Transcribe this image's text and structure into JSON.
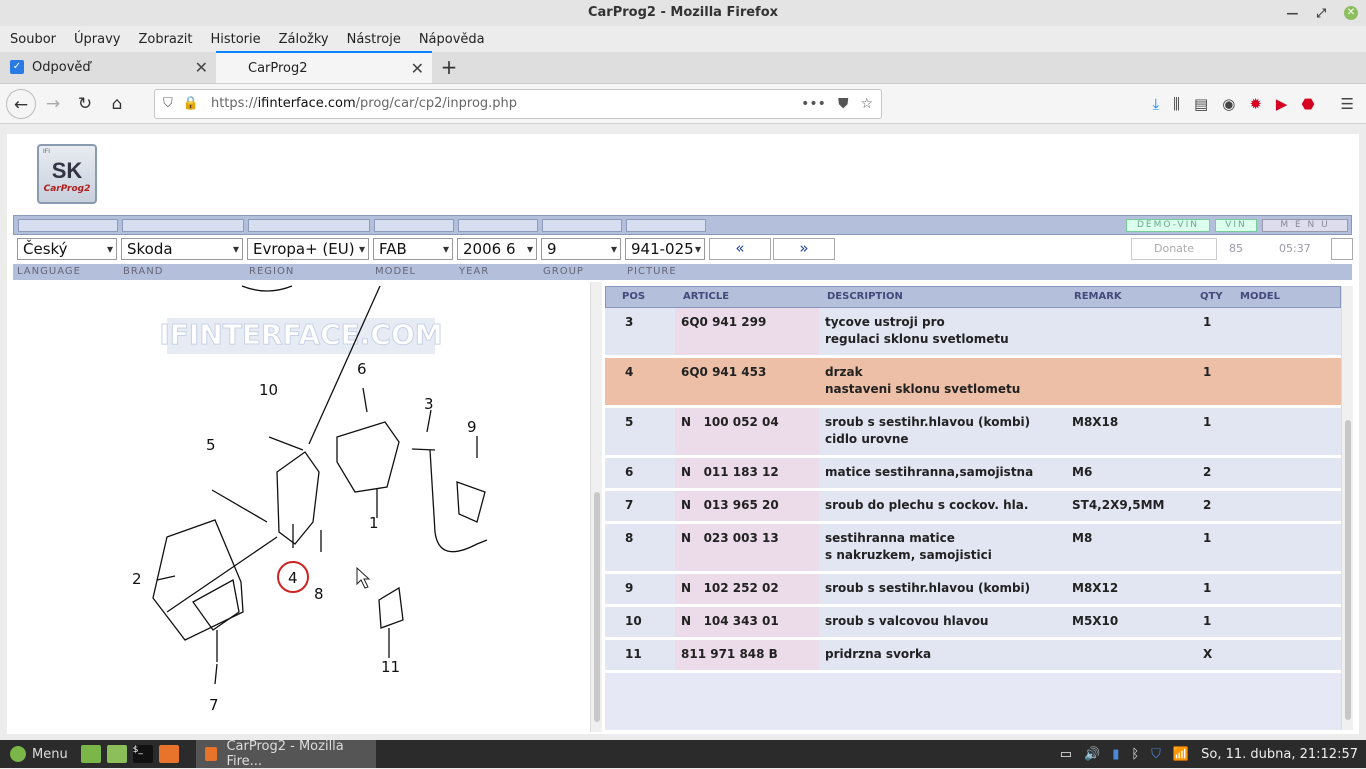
{
  "window": {
    "title": "CarProg2 - Mozilla Firefox"
  },
  "menubar": [
    "Soubor",
    "Úpravy",
    "Zobrazit",
    "Historie",
    "Záložky",
    "Nástroje",
    "Nápověda"
  ],
  "tabs": [
    {
      "label": "Odpověď",
      "active": false
    },
    {
      "label": "CarProg2",
      "active": true
    }
  ],
  "urlbar": {
    "url_prefix": "https://",
    "url_host": "ifinterface.com",
    "url_path": "/prog/car/cp2/inprog.php"
  },
  "logo": {
    "ifi": "IFI",
    "sk": "SK",
    "sub": "CarProg2"
  },
  "buttons": {
    "demo_vin": "DEMO-VIN",
    "vin": "VIN",
    "menu": "M E N U"
  },
  "selects": {
    "language": "Český",
    "brand": "Skoda",
    "region": "Evropa+ (EU)",
    "model": "FAB",
    "year": "2006  6",
    "group": "9",
    "picture": "941-025"
  },
  "nav": {
    "prev": "«",
    "next": "»"
  },
  "donate": "Donate",
  "counter": "85",
  "timer": "05:37",
  "labels": {
    "language": "LANGUAGE",
    "brand": "BRAND",
    "region": "REGION",
    "model": "MODEL",
    "year": "YEAR",
    "group": "GROUP",
    "picture": "PICTURE"
  },
  "diagram": {
    "watermark": "IFINTERFACE.COM",
    "callouts": [
      "10",
      "6",
      "3",
      "9",
      "5",
      "1",
      "2",
      "4",
      "8",
      "7",
      "11"
    ]
  },
  "table": {
    "headers": {
      "pos": "POS",
      "article": "ARTICLE",
      "description": "DESCRIPTION",
      "remark": "REMARK",
      "qty": "QTY",
      "model": "MODEL"
    },
    "rows": [
      {
        "pos": "3",
        "article": "6Q0 941 299",
        "desc1": "tycove ustroji pro",
        "desc2": "regulaci sklonu svetlometu",
        "remark": "",
        "qty": "1",
        "hl": false
      },
      {
        "pos": "4",
        "article": "6Q0 941 453",
        "desc1": "drzak",
        "desc2": "nastaveni sklonu svetlometu",
        "remark": "",
        "qty": "1",
        "hl": true
      },
      {
        "pos": "5",
        "article": "N   100 052 04",
        "desc1": "sroub s sestihr.hlavou (kombi)",
        "desc2": "cidlo urovne",
        "remark": "M8X18",
        "qty": "1",
        "hl": false
      },
      {
        "pos": "6",
        "article": "N   011 183 12",
        "desc1": "matice sestihranna,samojistna",
        "desc2": "",
        "remark": "M6",
        "qty": "2",
        "hl": false
      },
      {
        "pos": "7",
        "article": "N   013 965 20",
        "desc1": "sroub do plechu s cockov. hla.",
        "desc2": "",
        "remark": "ST4,2X9,5MM",
        "qty": "2",
        "hl": false
      },
      {
        "pos": "8",
        "article": "N   023 003 13",
        "desc1": "sestihranna matice",
        "desc2": "s nakruzkem, samojistici",
        "remark": "M8",
        "qty": "1",
        "hl": false
      },
      {
        "pos": "9",
        "article": "N   102 252 02",
        "desc1": "sroub s sestihr.hlavou (kombi)",
        "desc2": "",
        "remark": "M8X12",
        "qty": "1",
        "hl": false
      },
      {
        "pos": "10",
        "article": "N   104 343 01",
        "desc1": "sroub s valcovou hlavou",
        "desc2": "",
        "remark": "M5X10",
        "qty": "1",
        "hl": false
      },
      {
        "pos": "11",
        "article": "811 971 848 B",
        "desc1": "pridrzna svorka",
        "desc2": "",
        "remark": "",
        "qty": "X",
        "hl": false
      }
    ]
  },
  "taskbar": {
    "menu": "Menu",
    "window": "CarProg2 - Mozilla Fire...",
    "clock": "So, 11. dubna, 21:12:57"
  }
}
